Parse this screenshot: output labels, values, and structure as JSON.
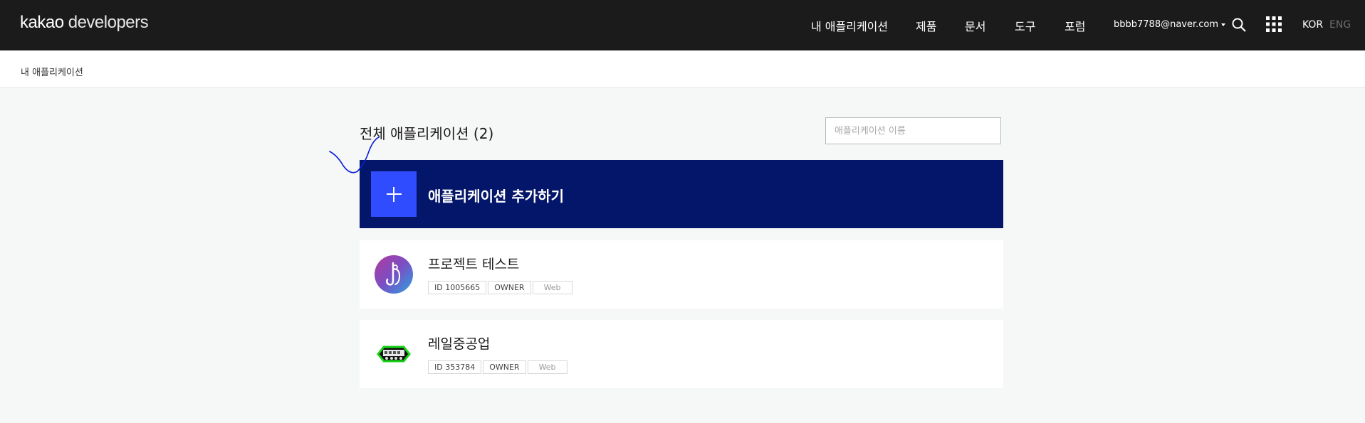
{
  "header": {
    "logo_main": "kakao",
    "logo_sub": " developers",
    "nav": [
      "내 애플리케이션",
      "제품",
      "문서",
      "도구",
      "포럼"
    ],
    "account": "bbbb7788@naver.com",
    "lang_kor": "KOR",
    "lang_eng": "ENG",
    "icons": [
      "search-icon",
      "apps-grid-icon",
      "caret-down-icon"
    ]
  },
  "breadcrumb": "내 애플리케이션",
  "main": {
    "title": "전체 애플리케이션 (2)",
    "search_placeholder": "애플리케이션 이름",
    "add_label": "애플리케이션 추가하기"
  },
  "apps": [
    {
      "name": "프로젝트 테스트",
      "id": "ID 1005665",
      "role": "OWNER",
      "platform": "Web"
    },
    {
      "name": "레일중공업",
      "id": "ID 353784",
      "role": "OWNER",
      "platform": "Web"
    }
  ],
  "colors": {
    "header_bg": "#1b1b1c",
    "add_card_bg": "#04166a",
    "add_button_bg": "#2f4dff",
    "page_bg": "#f6f7f7"
  }
}
